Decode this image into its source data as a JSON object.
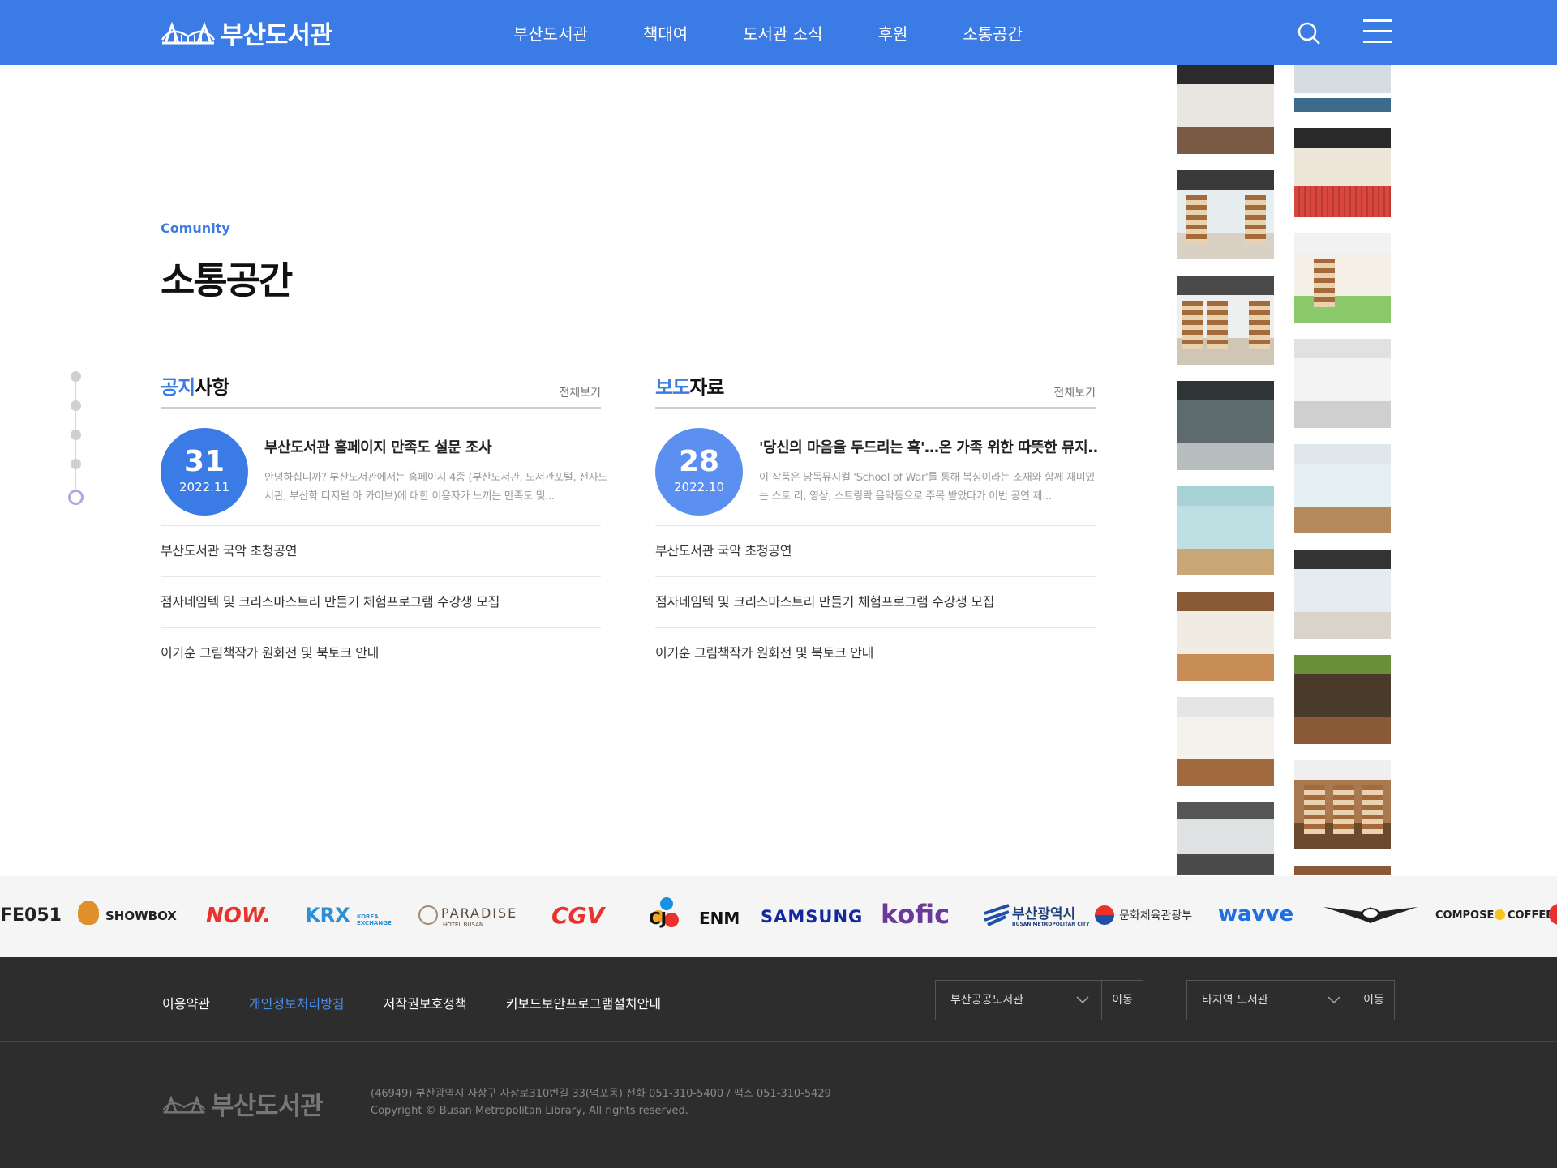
{
  "header": {
    "logo_text": "부산도서관",
    "nav": [
      "부산도서관",
      "책대여",
      "도서관 소식",
      "후원",
      "소통공간"
    ]
  },
  "section": {
    "eyebrow": "Comunity",
    "title": "소통공간"
  },
  "notice": {
    "title_accent": "공지",
    "title_rest": "사항",
    "more": "전체보기",
    "feature": {
      "day": "31",
      "ym": "2022.11",
      "title": "부산도서관 홈페이지 만족도 설문 조사",
      "desc": "안녕하십니까? 부산도서관에서는 홈페이지 4종 (부산도서관, 도서관포털, 전자도서관, 부산학 디지털 아 카이브)에 대한 이용자가 느끼는 만족도 및..."
    },
    "items": [
      "부산도서관 국악 초청공연",
      "점자네임텍 및 크리스마스트리 만들기 체험프로그램 수강생 모집",
      "이기훈 그림책작가 원화전 및 북토크 안내"
    ]
  },
  "press": {
    "title_accent": "보도",
    "title_rest": "자료",
    "more": "전체보기",
    "feature": {
      "day": "28",
      "ym": "2022.10",
      "title": "'당신의 마음을 두드리는 혹'…온 가족 위한 따뜻한 뮤지..",
      "desc": "이 작품은 낭독뮤지컬 'School of War'를 통해 복싱이라는 소재와 함께 재미있는 스토 리, 영상, 스트링락 음악등으로 주목 받았다가 이번 공연 제..."
    },
    "items": [
      "부산도서관 국악 초청공연",
      "점자네임텍 및 크리스마스트리 만들기 체험프로그램 수강생 모집",
      "이기훈 그림책작가 원화전 및 북토크 안내"
    ]
  },
  "partners": {
    "items": [
      "FE051",
      "SHOWBOX",
      "NOW.",
      "KRX",
      "KOREA EXCHANGE",
      "PARADISE",
      "HOTEL BUSAN",
      "CGV",
      "CJ",
      "ENM",
      "SAMSUNG",
      "kofic",
      "부산광역시",
      "BUSAN METROPOLITAN CITY",
      "문화체육관광부",
      "wavve",
      "COMPOSE",
      "COFFEE"
    ]
  },
  "footer": {
    "links": [
      "이용약관",
      "개인정보처리방침",
      "저작권보호정책",
      "키보드보안프로그램설치안내"
    ],
    "select1": "부산공공도서관",
    "select2": "타지역 도서관",
    "go_label": "이동",
    "logo_text": "부산도서관",
    "address": "(46949) 부산광역시 사상구 사상로310번길 33(덕포동) 전화 051-310-5400 / 팩스 051-310-5429",
    "copyright": "Copyright © Busan Metropolitan Library, All rights reserved."
  },
  "colors": {
    "brand": "#3a7be5",
    "footer_bg": "#2d2d2d",
    "link_highlight": "#4a8cf0"
  },
  "icons": [
    "bridge-logo-icon",
    "search-icon",
    "hamburger-menu-icon",
    "chevron-down-icon"
  ]
}
